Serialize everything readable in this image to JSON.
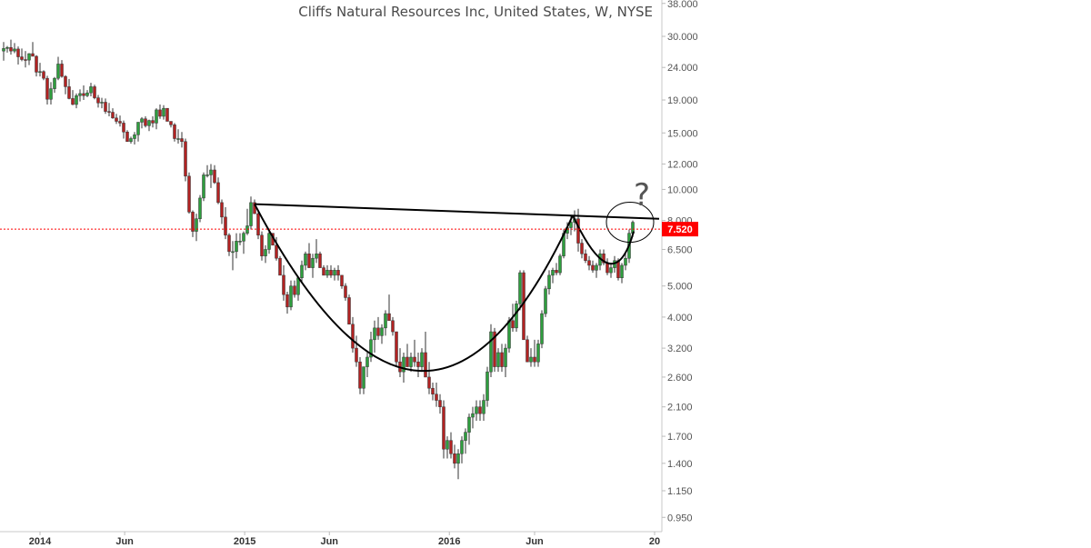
{
  "chart_data": {
    "type": "candlestick",
    "title": "Cliffs Natural Resources Inc, United States, W, NYSE",
    "y_scale": "log",
    "y_ticks": [
      0.95,
      1.15,
      1.4,
      1.7,
      2.1,
      2.6,
      3.2,
      4.0,
      5.0,
      6.5,
      8.0,
      10.0,
      12.0,
      15.0,
      19.0,
      24.0,
      30.0,
      38.0
    ],
    "y_tick_labels": [
      "0.950",
      "1.150",
      "1.400",
      "1.700",
      "2.100",
      "2.600",
      "3.200",
      "4.000",
      "5.000",
      "6.500",
      "8.000",
      "10.000",
      "12.000",
      "15.000",
      "19.000",
      "24.000",
      "30.000",
      "38.000"
    ],
    "x_tick_labels": [
      {
        "label": "2014",
        "date": "2014-01-01",
        "bold": true
      },
      {
        "label": "Jun",
        "date": "2014-06-01",
        "bold": false
      },
      {
        "label": "2015",
        "date": "2015-01-01",
        "bold": true
      },
      {
        "label": "Jun",
        "date": "2015-06-01",
        "bold": false
      },
      {
        "label": "2016",
        "date": "2016-01-01",
        "bold": true
      },
      {
        "label": "Jun",
        "date": "2016-06-01",
        "bold": false
      },
      {
        "label": "20",
        "date": "2017-01-01",
        "bold": true
      }
    ],
    "last_price": 7.52,
    "last_price_label": "7.520",
    "colors": {
      "up": "#2e9e3e",
      "down": "#b22222",
      "last_price": "#ff0000"
    },
    "annotations": [
      {
        "type": "trendline",
        "points": [
          [
            280,
            9.0
          ],
          [
            725,
            8.1
          ]
        ]
      },
      {
        "type": "cup",
        "points": [
          [
            280,
            9.0
          ],
          [
            470,
            1.35
          ],
          [
            630,
            8.3
          ]
        ]
      },
      {
        "type": "handle",
        "points": [
          [
            630,
            8.3
          ],
          [
            675,
            5.2
          ],
          [
            697,
            7.4
          ]
        ]
      },
      {
        "type": "ellipse",
        "center": [
          693,
          7.9
        ]
      },
      {
        "type": "question-mark",
        "text": "?"
      }
    ],
    "candles_x": [
      4,
      8,
      12,
      16,
      20,
      24,
      28,
      32,
      36,
      40,
      44,
      48,
      52,
      56,
      60,
      64,
      68,
      72,
      76,
      80,
      84,
      88,
      92,
      96,
      100,
      104,
      108,
      112,
      116,
      120,
      124,
      128,
      132,
      136,
      140,
      144,
      148,
      152,
      156,
      160,
      164,
      168,
      172,
      176,
      180,
      184,
      188,
      192,
      196,
      200,
      204,
      208,
      212,
      216,
      220,
      224,
      228,
      232,
      236,
      240,
      244,
      248,
      252,
      256,
      260,
      264,
      268,
      272,
      276,
      280,
      284,
      288,
      292,
      296,
      300,
      304,
      308,
      312,
      316,
      320,
      324,
      328,
      332,
      336,
      340,
      344,
      348,
      352,
      356,
      360,
      364,
      368,
      372,
      376,
      380,
      384,
      388,
      392,
      396,
      400,
      404,
      408,
      412,
      416,
      420,
      424,
      428,
      432,
      436,
      440,
      444,
      448,
      452,
      456,
      460,
      464,
      468,
      472,
      476,
      480,
      484,
      488,
      492,
      496,
      500,
      504,
      508,
      512,
      516,
      520,
      524,
      528,
      532,
      536,
      540,
      544,
      548,
      552,
      556,
      560,
      564,
      568,
      572,
      576,
      580,
      584,
      588,
      592,
      596,
      600,
      604,
      608,
      612,
      616,
      620,
      624,
      628,
      632,
      636,
      640,
      644,
      648,
      652,
      656,
      660,
      664,
      668,
      672,
      676,
      680,
      684,
      688,
      692,
      696
    ],
    "candles_ohlc": [
      [
        27.0,
        28.8,
        25.2,
        27.5
      ],
      [
        27.5,
        28.0,
        26.7,
        27.7
      ],
      [
        27.7,
        29.3,
        26.3,
        27.0
      ],
      [
        27.0,
        28.6,
        26.6,
        27.4
      ],
      [
        27.4,
        27.9,
        24.5,
        25.9
      ],
      [
        25.9,
        27.5,
        25.1,
        25.4
      ],
      [
        25.4,
        27.0,
        24.0,
        25.3
      ],
      [
        25.3,
        26.6,
        24.4,
        26.5
      ],
      [
        26.5,
        28.8,
        26.1,
        26.0
      ],
      [
        26.0,
        26.2,
        22.5,
        23.2
      ],
      [
        23.2,
        24.8,
        22.5,
        23.3
      ],
      [
        23.3,
        23.5,
        21.9,
        22.2
      ],
      [
        22.2,
        22.6,
        18.4,
        19.1
      ],
      [
        19.1,
        21.6,
        18.4,
        20.6
      ],
      [
        20.6,
        22.4,
        20.0,
        22.2
      ],
      [
        22.2,
        25.9,
        21.9,
        24.6
      ],
      [
        24.6,
        25.3,
        22.3,
        22.5
      ],
      [
        22.5,
        22.7,
        19.8,
        20.9
      ],
      [
        20.9,
        22.1,
        19.1,
        19.2
      ],
      [
        19.2,
        20.4,
        18.3,
        18.4
      ],
      [
        18.4,
        19.9,
        17.9,
        19.6
      ],
      [
        19.6,
        20.5,
        18.8,
        19.9
      ],
      [
        19.9,
        21.1,
        19.0,
        19.6
      ],
      [
        19.6,
        20.4,
        19.4,
        20.0
      ],
      [
        20.0,
        21.5,
        19.5,
        20.9
      ],
      [
        20.9,
        21.2,
        19.1,
        19.3
      ],
      [
        19.3,
        19.7,
        18.0,
        18.6
      ],
      [
        18.6,
        19.3,
        17.9,
        18.7
      ],
      [
        18.7,
        19.2,
        17.2,
        17.5
      ],
      [
        17.5,
        18.6,
        16.9,
        17.4
      ],
      [
        17.4,
        17.9,
        16.6,
        16.7
      ],
      [
        16.7,
        17.2,
        16.0,
        16.3
      ],
      [
        16.3,
        17.0,
        15.7,
        16.1
      ],
      [
        16.1,
        16.4,
        14.4,
        15.1
      ],
      [
        15.1,
        15.3,
        14.1,
        14.1
      ],
      [
        14.1,
        14.6,
        13.9,
        14.4
      ],
      [
        14.4,
        15.1,
        13.8,
        14.8
      ],
      [
        14.8,
        16.2,
        14.1,
        16.2
      ],
      [
        16.2,
        16.8,
        15.5,
        16.6
      ],
      [
        16.6,
        16.9,
        15.6,
        15.8
      ],
      [
        15.8,
        16.5,
        15.2,
        16.4
      ],
      [
        16.4,
        16.9,
        15.6,
        16.1
      ],
      [
        16.1,
        17.9,
        15.4,
        17.7
      ],
      [
        17.7,
        18.4,
        16.6,
        16.9
      ],
      [
        16.9,
        18.3,
        16.5,
        17.9
      ],
      [
        17.9,
        17.9,
        16.5,
        16.3
      ],
      [
        16.3,
        16.3,
        15.6,
        15.9
      ],
      [
        15.9,
        16.1,
        14.1,
        14.4
      ],
      [
        14.4,
        15.4,
        13.9,
        14.4
      ],
      [
        14.4,
        15.1,
        13.5,
        14.1
      ],
      [
        14.1,
        14.4,
        10.6,
        11.0
      ],
      [
        11.0,
        11.3,
        8.4,
        8.5
      ],
      [
        8.5,
        8.6,
        7.1,
        7.4
      ],
      [
        7.4,
        8.4,
        6.9,
        8.1
      ],
      [
        8.1,
        9.6,
        7.9,
        9.4
      ],
      [
        9.4,
        11.3,
        9.2,
        11.1
      ],
      [
        11.1,
        11.9,
        10.9,
        11.1
      ],
      [
        11.1,
        12.0,
        10.1,
        11.5
      ],
      [
        11.5,
        11.9,
        10.4,
        10.5
      ],
      [
        10.5,
        10.9,
        9.0,
        9.1
      ],
      [
        9.1,
        9.3,
        7.8,
        8.2
      ],
      [
        8.2,
        8.8,
        7.0,
        7.2
      ],
      [
        7.2,
        7.3,
        6.2,
        6.4
      ],
      [
        6.4,
        6.9,
        5.6,
        6.4
      ],
      [
        6.4,
        7.3,
        6.1,
        6.9
      ],
      [
        6.9,
        7.3,
        6.7,
        6.9
      ],
      [
        6.9,
        7.4,
        6.3,
        7.3
      ],
      [
        7.3,
        8.7,
        7.2,
        7.7
      ],
      [
        7.7,
        9.5,
        7.5,
        9.1
      ],
      [
        9.1,
        9.3,
        8.4,
        8.4
      ],
      [
        8.4,
        8.6,
        7.0,
        7.2
      ],
      [
        7.2,
        7.4,
        6.0,
        6.2
      ],
      [
        6.2,
        6.7,
        5.9,
        6.5
      ],
      [
        6.5,
        7.5,
        6.3,
        7.3
      ],
      [
        7.3,
        7.3,
        6.7,
        6.7
      ],
      [
        6.7,
        7.1,
        6.0,
        6.1
      ],
      [
        6.1,
        6.2,
        5.4,
        5.4
      ],
      [
        5.4,
        5.8,
        4.5,
        4.7
      ],
      [
        4.7,
        4.8,
        4.1,
        4.3
      ],
      [
        4.3,
        5.2,
        4.2,
        5.0
      ],
      [
        5.0,
        5.2,
        4.6,
        4.7
      ],
      [
        4.7,
        5.3,
        4.5,
        5.3
      ],
      [
        5.3,
        6.0,
        5.1,
        5.8
      ],
      [
        5.8,
        6.4,
        5.6,
        6.3
      ],
      [
        6.3,
        6.8,
        5.7,
        5.7
      ],
      [
        5.7,
        6.3,
        5.3,
        6.1
      ],
      [
        6.1,
        7.0,
        5.9,
        6.3
      ],
      [
        6.3,
        6.4,
        5.7,
        5.7
      ],
      [
        5.7,
        5.8,
        5.4,
        5.4
      ],
      [
        5.4,
        5.8,
        5.3,
        5.6
      ],
      [
        5.6,
        5.8,
        5.3,
        5.4
      ],
      [
        5.4,
        5.7,
        5.2,
        5.6
      ],
      [
        5.6,
        5.8,
        5.2,
        5.4
      ],
      [
        5.4,
        5.4,
        4.9,
        5.0
      ],
      [
        5.0,
        5.1,
        4.5,
        4.6
      ],
      [
        4.6,
        4.7,
        3.8,
        3.8
      ],
      [
        3.8,
        4.0,
        3.1,
        3.2
      ],
      [
        3.2,
        3.5,
        2.8,
        2.9
      ],
      [
        2.9,
        3.0,
        2.3,
        2.4
      ],
      [
        2.4,
        2.8,
        2.3,
        2.8
      ],
      [
        2.8,
        3.1,
        2.6,
        3.0
      ],
      [
        3.0,
        3.6,
        2.9,
        3.4
      ],
      [
        3.4,
        3.9,
        3.1,
        3.7
      ],
      [
        3.7,
        4.0,
        3.4,
        3.5
      ],
      [
        3.5,
        3.8,
        3.3,
        3.7
      ],
      [
        3.7,
        4.2,
        3.5,
        4.1
      ],
      [
        4.1,
        4.7,
        3.9,
        3.9
      ],
      [
        3.9,
        4.0,
        3.5,
        3.6
      ],
      [
        3.6,
        3.6,
        2.8,
        2.9
      ],
      [
        2.9,
        3.2,
        2.6,
        2.7
      ],
      [
        2.7,
        3.1,
        2.5,
        3.0
      ],
      [
        3.0,
        3.3,
        2.8,
        2.8
      ],
      [
        2.8,
        3.1,
        2.7,
        3.0
      ],
      [
        3.0,
        3.4,
        2.8,
        2.9
      ],
      [
        2.9,
        3.1,
        2.6,
        2.8
      ],
      [
        2.8,
        3.2,
        2.7,
        3.1
      ],
      [
        3.1,
        3.6,
        2.9,
        2.6
      ],
      [
        2.6,
        2.9,
        2.3,
        2.4
      ],
      [
        2.4,
        2.5,
        2.2,
        2.3
      ],
      [
        2.3,
        2.5,
        2.1,
        2.2
      ],
      [
        2.2,
        2.3,
        2.0,
        2.1
      ],
      [
        2.1,
        2.2,
        1.45,
        1.55
      ],
      [
        1.55,
        1.7,
        1.45,
        1.65
      ],
      [
        1.65,
        1.75,
        1.45,
        1.5
      ],
      [
        1.5,
        1.6,
        1.35,
        1.4
      ],
      [
        1.4,
        1.55,
        1.25,
        1.5
      ],
      [
        1.5,
        1.7,
        1.4,
        1.65
      ],
      [
        1.65,
        1.8,
        1.5,
        1.75
      ],
      [
        1.75,
        2.0,
        1.6,
        1.95
      ],
      [
        1.95,
        2.1,
        1.8,
        2.0
      ],
      [
        2.0,
        2.2,
        1.9,
        2.1
      ],
      [
        2.1,
        2.2,
        1.9,
        2.0
      ],
      [
        2.0,
        2.3,
        1.9,
        2.2
      ],
      [
        2.2,
        2.8,
        2.1,
        2.7
      ],
      [
        2.7,
        3.8,
        2.6,
        3.6
      ],
      [
        3.6,
        3.7,
        2.7,
        2.8
      ],
      [
        2.8,
        3.2,
        2.7,
        3.1
      ],
      [
        3.1,
        3.3,
        2.7,
        2.8
      ],
      [
        2.8,
        3.3,
        2.6,
        3.2
      ],
      [
        3.2,
        4.0,
        3.1,
        3.9
      ],
      [
        3.9,
        4.4,
        3.6,
        3.7
      ],
      [
        3.7,
        4.5,
        3.6,
        4.4
      ],
      [
        4.4,
        5.6,
        4.2,
        5.5
      ],
      [
        5.5,
        5.6,
        4.0,
        3.4
      ],
      [
        3.4,
        3.5,
        2.9,
        2.9
      ],
      [
        2.9,
        3.2,
        2.8,
        3.0
      ],
      [
        3.0,
        3.4,
        2.8,
        2.9
      ],
      [
        2.9,
        3.4,
        2.8,
        3.3
      ],
      [
        3.3,
        4.2,
        3.2,
        4.1
      ],
      [
        4.1,
        5.0,
        4.0,
        4.9
      ],
      [
        4.9,
        5.6,
        4.7,
        5.4
      ],
      [
        5.4,
        5.7,
        5.1,
        5.6
      ],
      [
        5.6,
        5.9,
        5.4,
        5.5
      ],
      [
        5.5,
        6.3,
        5.4,
        6.2
      ],
      [
        6.2,
        7.5,
        6.1,
        7.3
      ],
      [
        7.3,
        7.9,
        7.0,
        7.6
      ],
      [
        7.6,
        8.3,
        7.2,
        7.9
      ],
      [
        7.9,
        8.6,
        7.4,
        8.1
      ],
      [
        8.1,
        8.7,
        6.4,
        6.8
      ],
      [
        6.8,
        7.0,
        6.1,
        6.3
      ],
      [
        6.3,
        6.5,
        5.9,
        6.0
      ],
      [
        6.0,
        6.2,
        5.6,
        5.8
      ],
      [
        5.8,
        6.0,
        5.5,
        5.6
      ],
      [
        5.6,
        5.9,
        5.3,
        5.8
      ],
      [
        5.8,
        6.5,
        5.6,
        6.3
      ],
      [
        6.3,
        6.5,
        5.8,
        5.9
      ],
      [
        5.9,
        6.1,
        5.4,
        5.5
      ],
      [
        5.5,
        5.9,
        5.3,
        5.7
      ],
      [
        5.7,
        6.2,
        5.5,
        6.0
      ],
      [
        6.0,
        6.1,
        5.2,
        5.3
      ],
      [
        5.3,
        5.9,
        5.1,
        5.8
      ],
      [
        5.8,
        6.3,
        5.6,
        6.1
      ],
      [
        6.1,
        7.5,
        5.9,
        7.3
      ],
      [
        7.3,
        8.0,
        7.1,
        7.9
      ]
    ]
  }
}
